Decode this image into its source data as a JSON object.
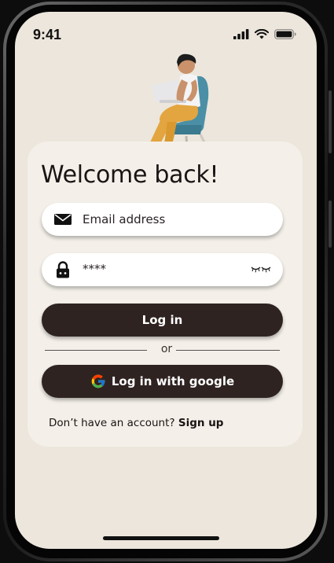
{
  "status_bar": {
    "time": "9:41"
  },
  "login": {
    "title": "Welcome back!",
    "email_placeholder": "Email address",
    "password_value": "****",
    "login_button": "Log in",
    "divider_text": "or",
    "google_button": "Log in with google",
    "signup_prompt": "Don’t have an account?",
    "signup_link": "Sign up"
  },
  "icons": {
    "email": "envelope-icon",
    "password": "lock-icon",
    "toggle_visibility": "closed-eye-icon",
    "google": "google-logo-icon",
    "signal": "cellular-signal-icon",
    "wifi": "wifi-icon",
    "battery": "battery-icon"
  },
  "colors": {
    "background": "#ece6dc",
    "card": "#f4f0e9",
    "button": "#2f2322",
    "text": "#1a1414"
  }
}
